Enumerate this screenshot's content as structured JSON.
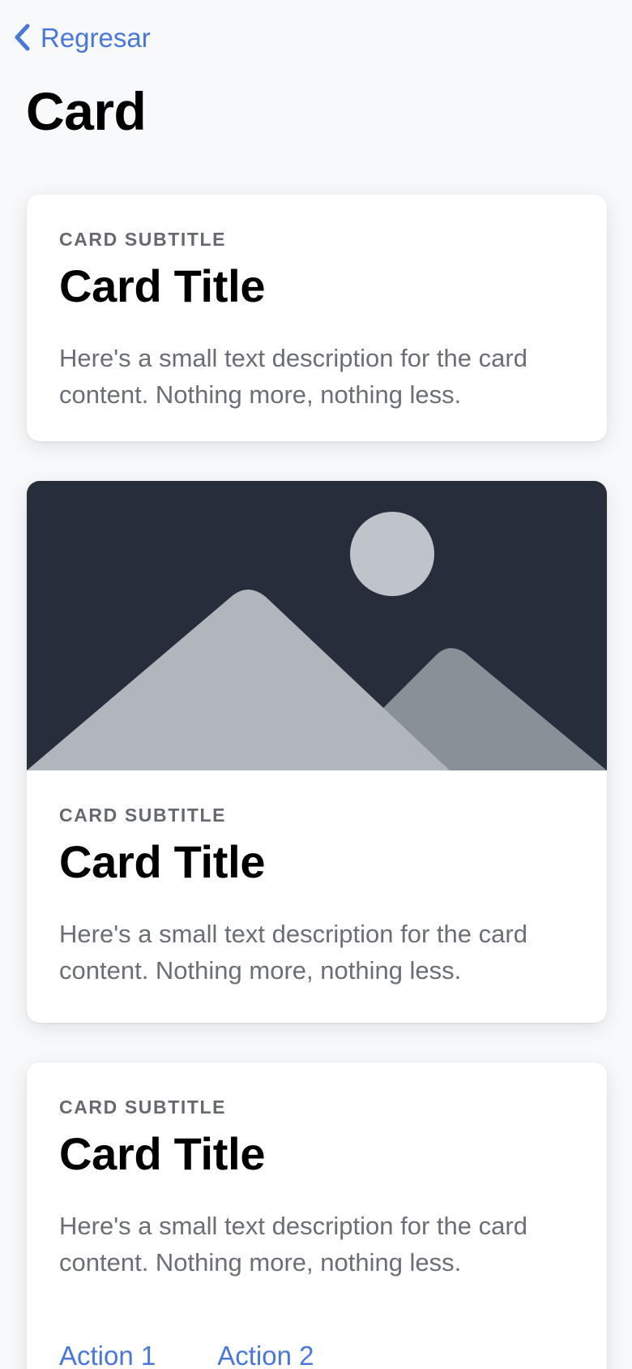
{
  "header": {
    "back_label": "Regresar",
    "title": "Card"
  },
  "cards": [
    {
      "subtitle": "Card Subtitle",
      "title": "Card Title",
      "text": "Here's a small text description for the card content. Nothing more, nothing less."
    },
    {
      "image": "landscape-placeholder",
      "subtitle": "Card Subtitle",
      "title": "Card Title",
      "text": "Here's a small text description for the card content. Nothing more, nothing less."
    },
    {
      "subtitle": "Card Subtitle",
      "title": "Card Title",
      "text": "Here's a small text description for the card content. Nothing more, nothing less.",
      "actions": [
        "Action 1",
        "Action 2"
      ]
    }
  ],
  "colors": {
    "accent": "#4a78d9",
    "background": "#f8f9fb",
    "card": "#ffffff",
    "image_background": "#272d3a",
    "mountain_front": "#b1b6bd",
    "mountain_back": "#8a9098",
    "sun": "#bfc4ca",
    "subtitle": "#666a70",
    "body_text": "#6b6f75"
  },
  "icons": {
    "back": "chevron-left-icon"
  }
}
